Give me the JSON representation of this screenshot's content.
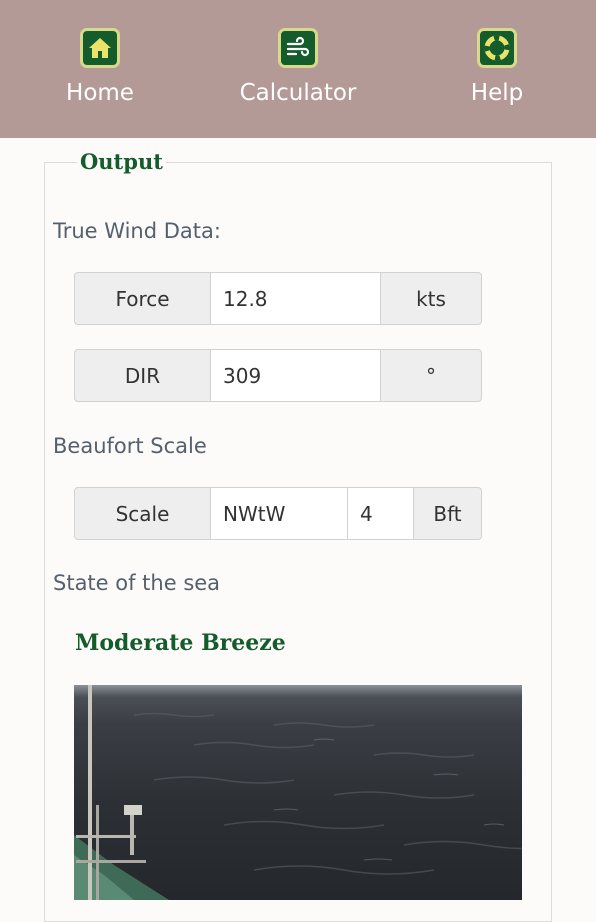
{
  "nav": {
    "items": [
      {
        "label": "Home",
        "icon": "home-icon"
      },
      {
        "label": "Calculator",
        "icon": "wind-icon"
      },
      {
        "label": "Help",
        "icon": "lifebuoy-icon"
      }
    ]
  },
  "output": {
    "legend": "Output",
    "true_wind": {
      "label": "True Wind Data:",
      "force": {
        "label": "Force",
        "value": "12.8",
        "unit": "kts"
      },
      "dir": {
        "label": "DIR",
        "value": "309",
        "unit": "°"
      }
    },
    "beaufort": {
      "label": "Beaufort Scale",
      "scale": {
        "label": "Scale",
        "direction": "NWtW",
        "value": "4",
        "unit": "Bft"
      }
    },
    "sea_state": {
      "label": "State of the sea",
      "title": "Moderate Breeze"
    }
  },
  "colors": {
    "nav_background": "#b39a96",
    "accent_green": "#145c2c",
    "icon_border": "#d8d98a"
  }
}
